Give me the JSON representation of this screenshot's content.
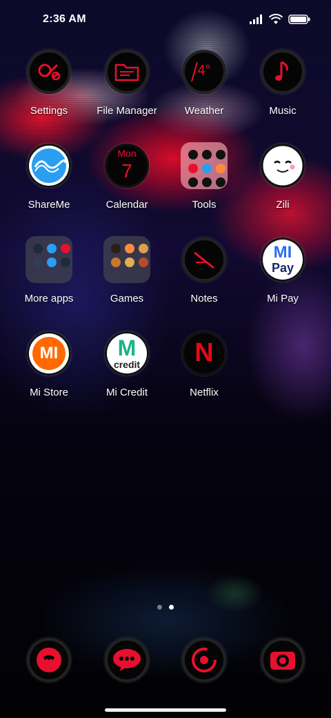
{
  "status_bar": {
    "time": "2:36 AM"
  },
  "apps": {
    "settings": {
      "label": "Settings",
      "icon": "settings-icon"
    },
    "file_manager": {
      "label": "File Manager",
      "icon": "folder-file-icon"
    },
    "weather": {
      "label": "Weather",
      "icon": "weather-icon",
      "temp": "4°"
    },
    "music": {
      "label": "Music",
      "icon": "music-note-icon"
    },
    "shareme": {
      "label": "ShareMe",
      "icon": "shareme-icon"
    },
    "calendar": {
      "label": "Calendar",
      "icon": "calendar-icon",
      "day": "Mon",
      "date": "7"
    },
    "tools": {
      "label": "Tools",
      "icon": "tools-folder-icon"
    },
    "zili": {
      "label": "Zili",
      "icon": "zili-face-icon"
    },
    "more_apps": {
      "label": "More apps",
      "icon": "more-apps-folder-icon"
    },
    "games": {
      "label": "Games",
      "icon": "games-folder-icon"
    },
    "notes": {
      "label": "Notes",
      "icon": "notes-icon"
    },
    "mi_pay": {
      "label": "Mi Pay",
      "icon": "mi-pay-icon",
      "logo_top": "MI",
      "logo_bottom": "Pay"
    },
    "mi_store": {
      "label": "Mi Store",
      "icon": "mi-store-icon",
      "logo": "MI"
    },
    "mi_credit": {
      "label": "Mi Credit",
      "icon": "mi-credit-icon",
      "logo_top": "M",
      "logo_bottom": "credit"
    },
    "netflix": {
      "label": "Netflix",
      "icon": "netflix-icon",
      "logo": "N"
    }
  },
  "page_indicator": {
    "pages": 2,
    "active": 2
  },
  "dock": [
    {
      "icon": "phone-icon"
    },
    {
      "icon": "messages-icon"
    },
    {
      "icon": "browser-icon"
    },
    {
      "icon": "camera-icon"
    }
  ],
  "colors": {
    "accent_red": "#e8102d",
    "shareme_blue": "#2a9ef0",
    "mi_orange": "#ff6900",
    "netflix_red": "#e50914",
    "mi_credit_green": "#1bb38a"
  }
}
